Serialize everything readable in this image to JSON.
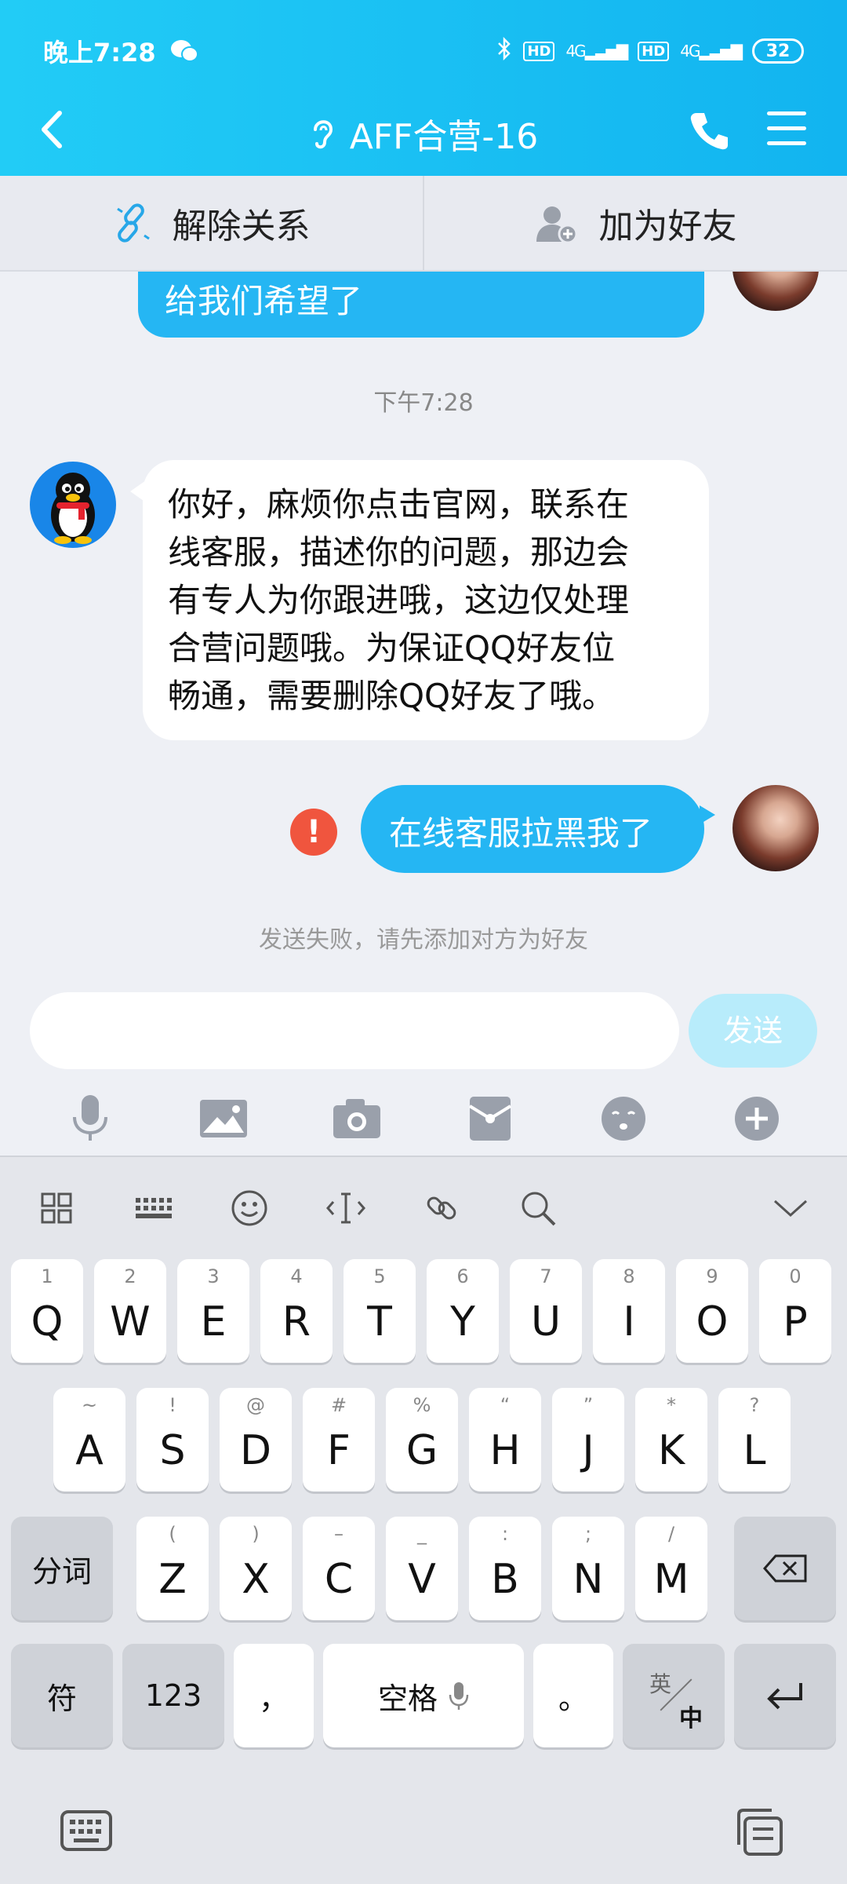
{
  "status": {
    "time": "晚上7:28",
    "battery": "32",
    "hd1": "HD",
    "net1": "4G",
    "hd2": "HD",
    "net2": "4G"
  },
  "nav": {
    "title": "AFF合营-16"
  },
  "actions": {
    "unlink": "解除关系",
    "add_friend": "加为好友"
  },
  "chat": {
    "prev_message": "给我们希望了",
    "timestamp": "下午7:28",
    "received": [
      "你好，麻烦你点击官网，联系在",
      "线客服，描述你的问题，那边会",
      "有专人为你跟进哦，这边仅处理",
      "合营问题哦。为保证QQ好友位",
      "畅通，需要删除QQ好友了哦。"
    ],
    "sent": "在线客服拉黑我了",
    "error_mark": "!",
    "fail_note": "发送失败，请先添加对方为好友"
  },
  "input": {
    "send_label": "发送",
    "placeholder": ""
  },
  "keyboard": {
    "row1": [
      {
        "k": "Q",
        "s": "1"
      },
      {
        "k": "W",
        "s": "2"
      },
      {
        "k": "E",
        "s": "3"
      },
      {
        "k": "R",
        "s": "4"
      },
      {
        "k": "T",
        "s": "5"
      },
      {
        "k": "Y",
        "s": "6"
      },
      {
        "k": "U",
        "s": "7"
      },
      {
        "k": "I",
        "s": "8"
      },
      {
        "k": "O",
        "s": "9"
      },
      {
        "k": "P",
        "s": "0"
      }
    ],
    "row2": [
      {
        "k": "A",
        "s": "~"
      },
      {
        "k": "S",
        "s": "!"
      },
      {
        "k": "D",
        "s": "@"
      },
      {
        "k": "F",
        "s": "#"
      },
      {
        "k": "G",
        "s": "%"
      },
      {
        "k": "H",
        "s": "“"
      },
      {
        "k": "J",
        "s": "”"
      },
      {
        "k": "K",
        "s": "*"
      },
      {
        "k": "L",
        "s": "?"
      }
    ],
    "row3": [
      {
        "k": "Z",
        "s": "("
      },
      {
        "k": "X",
        "s": ")"
      },
      {
        "k": "C",
        "s": "–"
      },
      {
        "k": "V",
        "s": "_"
      },
      {
        "k": "B",
        "s": ":"
      },
      {
        "k": "N",
        "s": ";"
      },
      {
        "k": "M",
        "s": "/"
      }
    ],
    "fenci": "分词",
    "fu": "符",
    "num": "123",
    "comma": "，",
    "space": "空格",
    "period": "。",
    "lang_top": "英",
    "lang_bottom": "中"
  }
}
